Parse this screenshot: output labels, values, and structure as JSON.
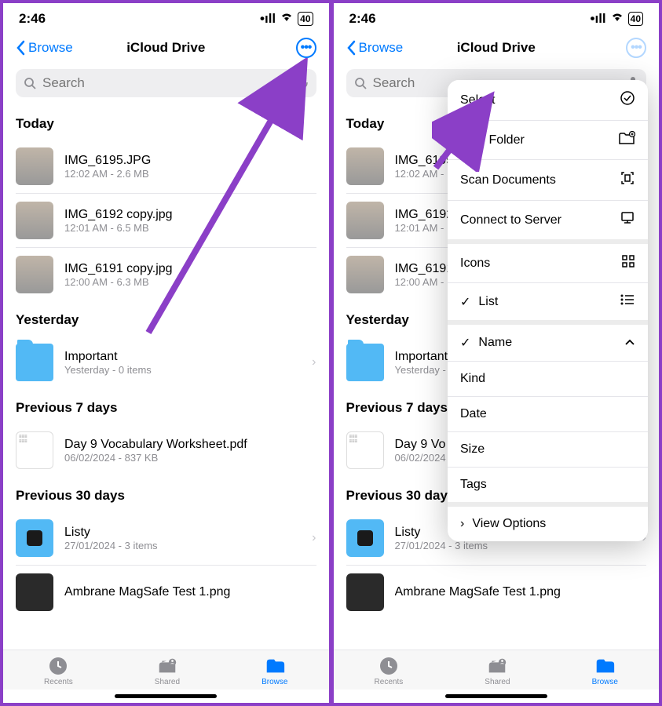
{
  "statusTime": "2:46",
  "battery": "40",
  "nav": {
    "back": "Browse",
    "title": "iCloud Drive"
  },
  "search": {
    "placeholder": "Search"
  },
  "sections": [
    {
      "title": "Today",
      "items": [
        {
          "name": "IMG_6195.JPG",
          "meta": "12:02 AM - 2.6 MB",
          "type": "img"
        },
        {
          "name": "IMG_6192 copy.jpg",
          "meta": "12:01 AM - 6.5 MB",
          "type": "img"
        },
        {
          "name": "IMG_6191 copy.jpg",
          "meta": "12:00 AM - 6.3 MB",
          "type": "img"
        }
      ]
    },
    {
      "title": "Yesterday",
      "items": [
        {
          "name": "Important",
          "meta": "Yesterday - 0 items",
          "type": "folder",
          "chevron": true
        }
      ]
    },
    {
      "title": "Previous 7 days",
      "items": [
        {
          "name": "Day 9 Vocabulary Worksheet.pdf",
          "meta": "06/02/2024 - 837 KB",
          "type": "pdf"
        }
      ]
    },
    {
      "title": "Previous 30 days",
      "items": [
        {
          "name": "Listy",
          "meta": "27/01/2024 - 3 items",
          "type": "listy",
          "chevron": true
        },
        {
          "name": "Ambrane MagSafe Test 1.png",
          "meta": "",
          "type": "dark"
        }
      ]
    }
  ],
  "sections_truncated": [
    {
      "title": "Today",
      "items": [
        {
          "name": "IMG_6195",
          "meta": "12:02 AM -",
          "type": "img"
        },
        {
          "name": "IMG_6192",
          "meta": "12:01 AM -",
          "type": "img"
        },
        {
          "name": "IMG_6191",
          "meta": "12:00 AM -",
          "type": "img"
        }
      ]
    },
    {
      "title": "Yesterday",
      "items": [
        {
          "name": "Important",
          "meta": "Yesterday -",
          "type": "folder"
        }
      ]
    },
    {
      "title": "Previous 7 days",
      "items": [
        {
          "name": "Day 9 Vo",
          "meta": "06/02/2024",
          "type": "pdf"
        }
      ]
    },
    {
      "title": "Previous 30 days",
      "items": [
        {
          "name": "Listy",
          "meta": "27/01/2024 - 3 items",
          "type": "listy",
          "chevron": true
        },
        {
          "name": "Ambrane MagSafe Test 1.png",
          "meta": "",
          "type": "dark"
        }
      ]
    }
  ],
  "tabs": [
    {
      "label": "Recents",
      "icon": "clock",
      "active": false
    },
    {
      "label": "Shared",
      "icon": "shared",
      "active": false
    },
    {
      "label": "Browse",
      "icon": "folder",
      "active": true
    }
  ],
  "dropdown": {
    "group1": [
      {
        "label": "Select",
        "icon": "check-circle"
      },
      {
        "label": "New Folder",
        "icon": "folder-plus"
      },
      {
        "label": "Scan Documents",
        "icon": "scan"
      },
      {
        "label": "Connect to Server",
        "icon": "server"
      }
    ],
    "group2": [
      {
        "label": "Icons",
        "icon": "grid",
        "checked": false
      },
      {
        "label": "List",
        "icon": "list",
        "checked": true
      }
    ],
    "group3": [
      {
        "label": "Name",
        "checked": true,
        "icon": "chevron-up"
      },
      {
        "label": "Kind"
      },
      {
        "label": "Date"
      },
      {
        "label": "Size"
      },
      {
        "label": "Tags"
      }
    ],
    "viewOptions": "View Options"
  }
}
